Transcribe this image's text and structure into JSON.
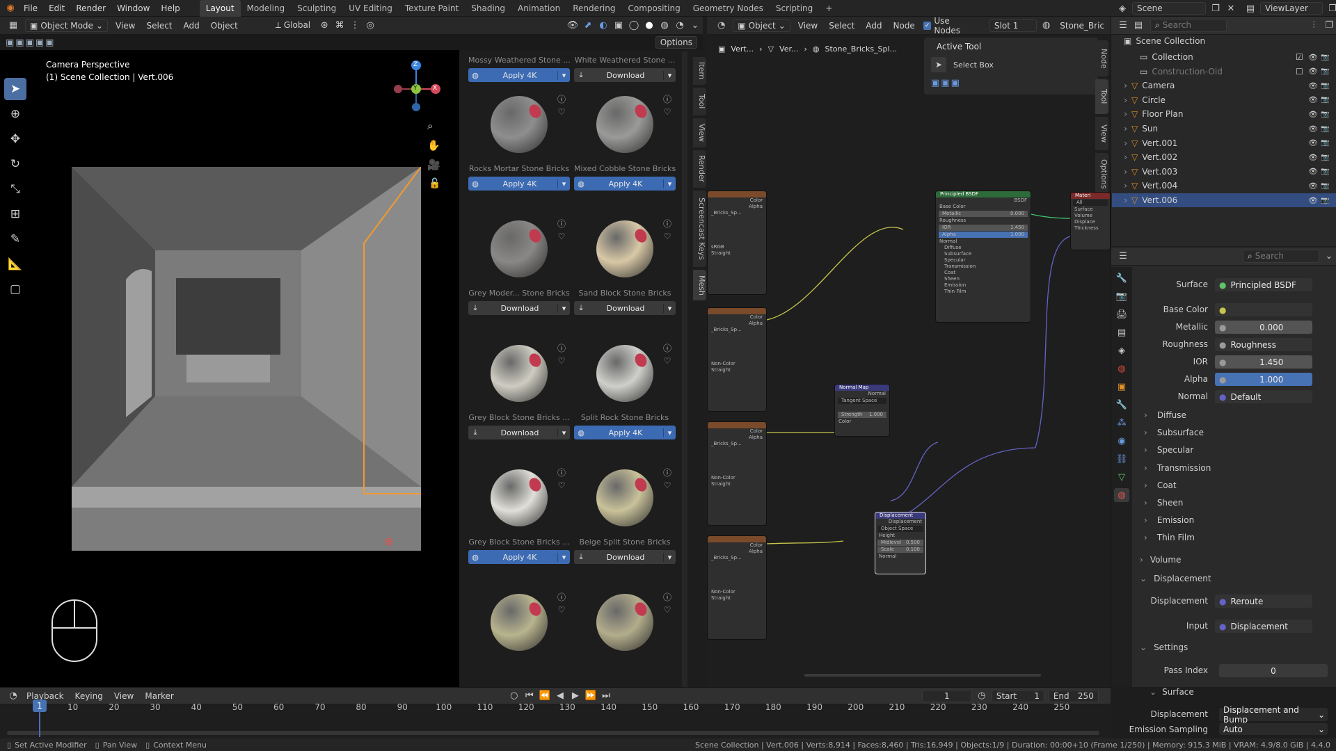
{
  "topbar": {
    "menus": [
      "File",
      "Edit",
      "Render",
      "Window",
      "Help"
    ],
    "workspaces": [
      "Layout",
      "Modeling",
      "Sculpting",
      "UV Editing",
      "Texture Paint",
      "Shading",
      "Animation",
      "Rendering",
      "Compositing",
      "Geometry Nodes",
      "Scripting"
    ],
    "active_workspace": "Layout",
    "scene": "Scene",
    "view_layer": "ViewLayer"
  },
  "viewport": {
    "mode": "Object Mode",
    "menus": [
      "View",
      "Select",
      "Add",
      "Object"
    ],
    "orientation": "Global",
    "options_label": "Options",
    "overlay_title": "Camera Perspective",
    "overlay_sub": "(1) Scene Collection | Vert.006",
    "gizmo": {
      "x": "X",
      "y": "Y",
      "z": "Z"
    }
  },
  "asset_browser": {
    "cards": [
      {
        "name": "Mossy Weathered Stone ...",
        "button": "Apply 4K",
        "style": "blue",
        "icon": "globe-icon"
      },
      {
        "name": "White Weathered Stone ...",
        "button": "Download",
        "style": "gray",
        "icon": "download-icon"
      },
      {
        "name": "Rocks Mortar Stone Bricks",
        "button": "Apply 4K",
        "style": "blue",
        "icon": "globe-icon",
        "color": "#8e8e8e"
      },
      {
        "name": "Mixed Cobble Stone Bricks",
        "button": "Apply 4K",
        "style": "blue",
        "icon": "globe-icon",
        "color": "#9a9a98"
      },
      {
        "name": "Grey Moder... Stone Bricks",
        "button": "Download",
        "style": "gray",
        "icon": "download-icon",
        "color": "#8a8886"
      },
      {
        "name": "Sand Block Stone Bricks",
        "button": "Download",
        "style": "gray",
        "icon": "download-icon",
        "color": "#d8c8a6"
      },
      {
        "name": "Grey Block Stone Bricks ...",
        "button": "Download",
        "style": "gray",
        "icon": "download-icon",
        "color": "#cfcdc2"
      },
      {
        "name": "Split Rock Stone Bricks",
        "button": "Apply 4K",
        "style": "blue",
        "icon": "globe-icon",
        "color": "#cfcfcb"
      },
      {
        "name": "Grey Block Stone Bricks ...",
        "button": "Apply 4K",
        "style": "blue",
        "icon": "globe-icon",
        "color": "#e0dfd9"
      },
      {
        "name": "Beige Split Stone Bricks",
        "button": "Download",
        "style": "gray",
        "icon": "download-icon",
        "color": "#c9c29a"
      },
      {
        "name": "",
        "button": "",
        "style": "none",
        "icon": "",
        "color": "#b8b48e"
      },
      {
        "name": "",
        "button": "",
        "style": "none",
        "icon": "",
        "color": "#b3ad8c"
      }
    ],
    "side_tabs": [
      "Item",
      "Tool",
      "View",
      "Render",
      "Screencast Keys",
      "Mesh"
    ]
  },
  "node_editor": {
    "object_label": "Object",
    "menus": [
      "View",
      "Select",
      "Add",
      "Node"
    ],
    "use_nodes": "Use Nodes",
    "slot": "Slot 1",
    "material": "Stone_Bric",
    "breadcrumb": [
      "Vert...",
      "Ver...",
      "Stone_Bricks_Spl..."
    ],
    "active_tool_title": "Active Tool",
    "select_box": "Select Box",
    "side_tabs": [
      "Node",
      "Tool",
      "View",
      "Options"
    ],
    "nodes": {
      "bsdf_title": "Principled BSDF",
      "bsdf_out": "BSDF",
      "bsdf_rows": [
        "Base Color",
        "Metallic",
        "Roughness",
        "IOR",
        "Alpha",
        "Normal",
        "Diffuse",
        "Subsurface",
        "Specular",
        "Transmission",
        "Coat",
        "Sheen",
        "Emission",
        "Thin Film"
      ],
      "bsdf_values": {
        "metallic": "0.000",
        "ior": "1.450",
        "alpha": "1.000"
      },
      "normal_map_title": "Normal Map",
      "normal_map_rows": [
        "Normal",
        "Tangent Space",
        "Strength",
        "Color"
      ],
      "normal_strength": "1.000",
      "displacement_title": "Displacement",
      "displacement_rows": [
        "Displacement",
        "Object Space",
        "Height",
        "Midlevel",
        "Scale",
        "Normal"
      ],
      "displacement_values": {
        "midlevel": "0.500",
        "scale": "0.100"
      },
      "output_title": "Materi",
      "output_rows": [
        "All",
        "Surface",
        "Volume",
        "Displace",
        "Thickness"
      ],
      "image_node_rows": [
        "Color",
        "Alpha"
      ],
      "image_name": "_Bricks_Sp...",
      "color_spaces": [
        "sRGB",
        "Non-Color",
        "Non-Color",
        "Non-Color"
      ],
      "interp": "Straight"
    }
  },
  "outliner": {
    "search_placeholder": "Search",
    "root": "Scene Collection",
    "items": [
      {
        "name": "Collection",
        "level": 1,
        "selected": false,
        "dim": false
      },
      {
        "name": "Construction-Old",
        "level": 1,
        "selected": false,
        "dim": true
      },
      {
        "name": "Camera",
        "level": 2,
        "selected": false,
        "dim": false
      },
      {
        "name": "Circle",
        "level": 2,
        "selected": false,
        "dim": false
      },
      {
        "name": "Floor Plan",
        "level": 2,
        "selected": false,
        "dim": false
      },
      {
        "name": "Sun",
        "level": 2,
        "selected": false,
        "dim": false
      },
      {
        "name": "Vert.001",
        "level": 2,
        "selected": false,
        "dim": false
      },
      {
        "name": "Vert.002",
        "level": 2,
        "selected": false,
        "dim": false
      },
      {
        "name": "Vert.003",
        "level": 2,
        "selected": false,
        "dim": false
      },
      {
        "name": "Vert.004",
        "level": 2,
        "selected": false,
        "dim": false
      },
      {
        "name": "Vert.006",
        "level": 2,
        "selected": true,
        "dim": false
      }
    ]
  },
  "properties": {
    "search_placeholder": "Search",
    "surface_label": "Surface",
    "surface_value": "Principled BSDF",
    "rows": [
      {
        "label": "Base Color",
        "value": ""
      },
      {
        "label": "Metallic",
        "value": "0.000"
      },
      {
        "label": "Roughness",
        "value": "Roughness"
      },
      {
        "label": "IOR",
        "value": "1.450"
      },
      {
        "label": "Alpha",
        "value": "1.000"
      },
      {
        "label": "Normal",
        "value": "Default"
      }
    ],
    "subsections": [
      "Diffuse",
      "Subsurface",
      "Specular",
      "Transmission",
      "Coat",
      "Sheen",
      "Emission",
      "Thin Film"
    ],
    "volume": "Volume",
    "displacement_section": "Displacement",
    "displacement_label": "Displacement",
    "displacement_value": "Reroute",
    "input_label": "Input",
    "input_value": "Displacement",
    "settings": "Settings",
    "pass_index_label": "Pass Index",
    "pass_index_value": "0",
    "surface_sub": "Surface",
    "disp_method_label": "Displacement",
    "disp_method_value": "Displacement and Bump",
    "emission_sampling_label": "Emission Sampling",
    "emission_sampling_value": "Auto"
  },
  "timeline": {
    "menus": [
      "Playback",
      "Keying",
      "View",
      "Marker"
    ],
    "current_frame": "1",
    "start_label": "Start",
    "start": "1",
    "end_label": "End",
    "end": "250",
    "ticks": [
      "10",
      "20",
      "30",
      "40",
      "50",
      "60",
      "70",
      "80",
      "90",
      "100",
      "110",
      "120",
      "130",
      "140",
      "150",
      "160",
      "170",
      "180",
      "190",
      "200",
      "210",
      "220",
      "230",
      "240",
      "250"
    ],
    "playhead": "1"
  },
  "statusbar": {
    "hints": [
      "Set Active Modifier",
      "Pan View",
      "Context Menu"
    ],
    "stats": "Scene Collection | Vert.006 | Verts:8,914 | Faces:8,460 | Tris:16,949 | Objects:1/9 | Duration: 00:00+10 (Frame 1/250) | Memory: 915.3 MiB | VRAM: 4.9/8.0 GiB | 4.4.0"
  },
  "colors": {
    "accent": "#4772b3",
    "selected_row": "#334d80",
    "bsdf_header": "#2d6b3a",
    "displacement_header": "#3a3a7a",
    "image_header": "#7a4a2a"
  }
}
